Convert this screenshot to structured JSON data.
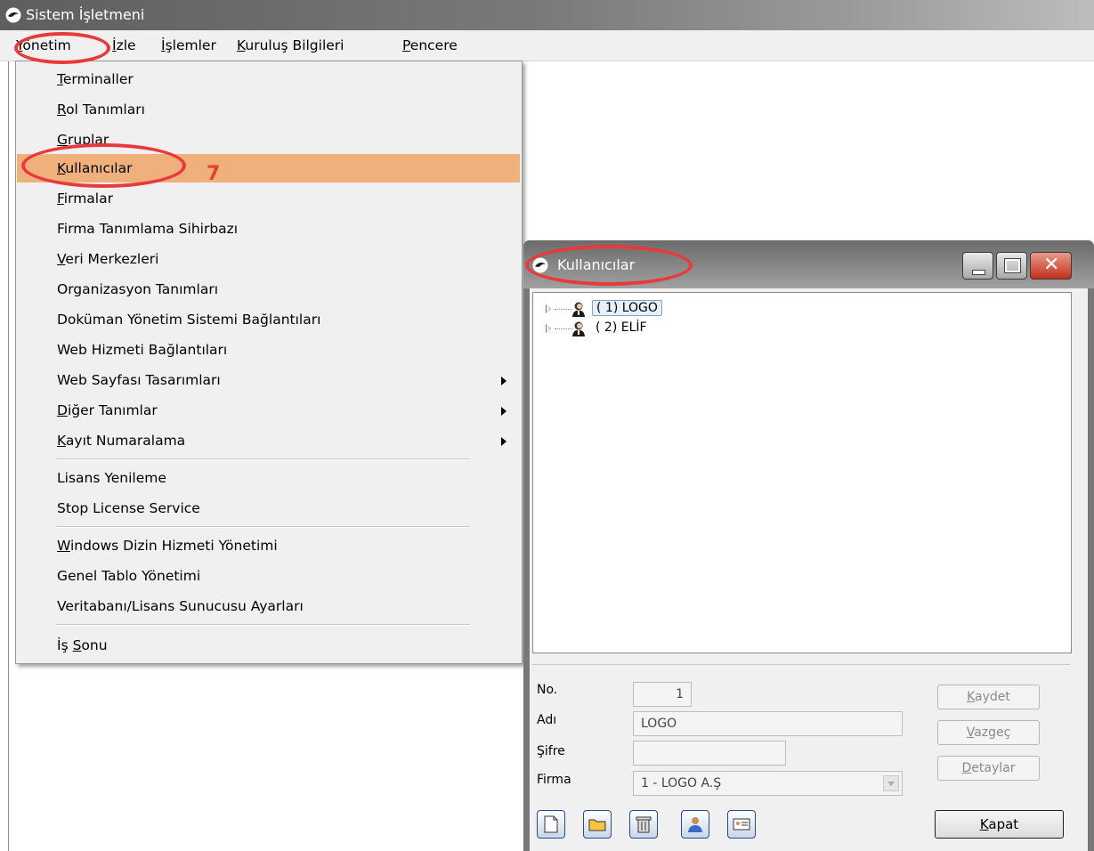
{
  "app": {
    "title": "Sistem İşletmeni"
  },
  "menubar": [
    {
      "label": "Yönetim",
      "key": "Y",
      "rest": "önetim"
    },
    {
      "label": "İzle",
      "key": "İ",
      "rest": "zle"
    },
    {
      "label": "İşlemler",
      "key": "İ",
      "rest": "şlemler"
    },
    {
      "label": "Kuruluş Bilgileri",
      "key": "K",
      "rest": "uruluş Bilgileri"
    },
    {
      "label": "Pencere",
      "key": "P",
      "rest": "encere"
    }
  ],
  "dropdown": {
    "items": [
      {
        "key": "T",
        "rest": "erminaller"
      },
      {
        "key": "R",
        "rest": "ol Tanımları"
      },
      {
        "key": "G",
        "rest": "ruplar"
      },
      {
        "key": "K",
        "rest": "ullanıcılar",
        "highlighted": true
      },
      {
        "key": "F",
        "rest": "irmalar"
      },
      {
        "key": "",
        "rest": "Firma Tanımlama Sihirbazı"
      },
      {
        "key": "V",
        "rest": "eri Merkezleri"
      },
      {
        "key": "",
        "rest": "Organizasyon Tanımları"
      },
      {
        "key": "",
        "rest": "Doküman Yönetim Sistemi Bağlantıları"
      },
      {
        "key": "",
        "rest": "Web Hizmeti Bağlantıları"
      },
      {
        "key": "",
        "rest": "Web Sayfası Tasarımları",
        "submenu": true
      },
      {
        "key": "D",
        "rest": "iğer Tanımlar",
        "submenu": true
      },
      {
        "key": "K",
        "rest": "ayıt Numaralama",
        "submenu": true
      },
      {
        "key": "",
        "rest": "Lisans Yenileme"
      },
      {
        "key": "",
        "rest": "Stop License Service"
      },
      {
        "key": "W",
        "rest": "indows Dizin Hizmeti Yönetimi"
      },
      {
        "key": "",
        "rest": "Genel Tablo Yönetimi"
      },
      {
        "key": "",
        "rest": "Veritabanı/Lisans Sunucusu Ayarları"
      },
      {
        "key": "",
        "rest": "İş ",
        "key2": "S",
        "rest2": "onu"
      }
    ]
  },
  "annotation": {
    "step": "7"
  },
  "child_window": {
    "title": "Kullanıcılar",
    "tree": [
      {
        "label": "( 1) LOGO",
        "selected": true
      },
      {
        "label": "( 2) ELİF",
        "selected": false
      }
    ],
    "form": {
      "no_label": "No.",
      "no_value": "1",
      "name_label": "Adı",
      "name_value": "LOGO",
      "password_label": "Şifre",
      "password_value": "",
      "firm_label": "Firma",
      "firm_value": "1 - LOGO A.Ş",
      "save_key": "K",
      "save_rest": "aydet",
      "cancel_key": "V",
      "cancel_rest": "azgeç",
      "details_key": "D",
      "details_rest": "etaylar",
      "close_key": "K",
      "close_rest": "apat"
    }
  },
  "colors": {
    "highlight": "#efb07c",
    "annotation": "#e83a3a"
  }
}
